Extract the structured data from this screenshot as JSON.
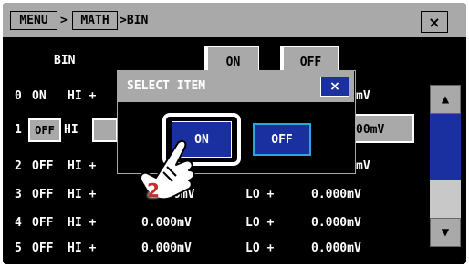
{
  "titlebar": {
    "crumbs": [
      "MENU",
      ">",
      "MATH",
      ">BIN"
    ],
    "close_icon": "×"
  },
  "header": {
    "label": "BIN",
    "on_button": "ON",
    "off_button": "OFF"
  },
  "rows": [
    {
      "index": "0",
      "state": "ON",
      "hi": "HI +",
      "hi_value": "",
      "lo": "",
      "lo_value": "mV"
    },
    {
      "index": "1",
      "state": "OFF",
      "hi": "HI",
      "hi_value": "",
      "lo": "",
      "lo_value": "00mV"
    },
    {
      "index": "2",
      "state": "OFF",
      "hi": "HI +",
      "hi_value": "",
      "lo": "",
      "lo_value": "mV"
    },
    {
      "index": "3",
      "state": "OFF",
      "hi": "HI +",
      "hi_value": "0mV",
      "lo": "LO +",
      "lo_value": "0.000mV"
    },
    {
      "index": "4",
      "state": "OFF",
      "hi": "HI +",
      "hi_value": "0.000mV",
      "lo": "LO +",
      "lo_value": "0.000mV"
    },
    {
      "index": "5",
      "state": "OFF",
      "hi": "HI +",
      "hi_value": "0.000mV",
      "lo": "LO +",
      "lo_value": "0.000mV"
    }
  ],
  "scrollbar": {
    "up_icon": "▲",
    "down_icon": "▼"
  },
  "dialog": {
    "title": "SELECT ITEM",
    "close_icon": "×",
    "on_label": "ON",
    "off_label": "OFF"
  },
  "annotation": {
    "step_number": "2",
    "icon": "pointing-hand-icon"
  },
  "colors": {
    "background": "#000000",
    "bar_grey": "#a9a9a9",
    "selection_blue": "#1a2fa0",
    "focus_cyan": "#2aa6e0",
    "badge_red": "#c0302e"
  }
}
